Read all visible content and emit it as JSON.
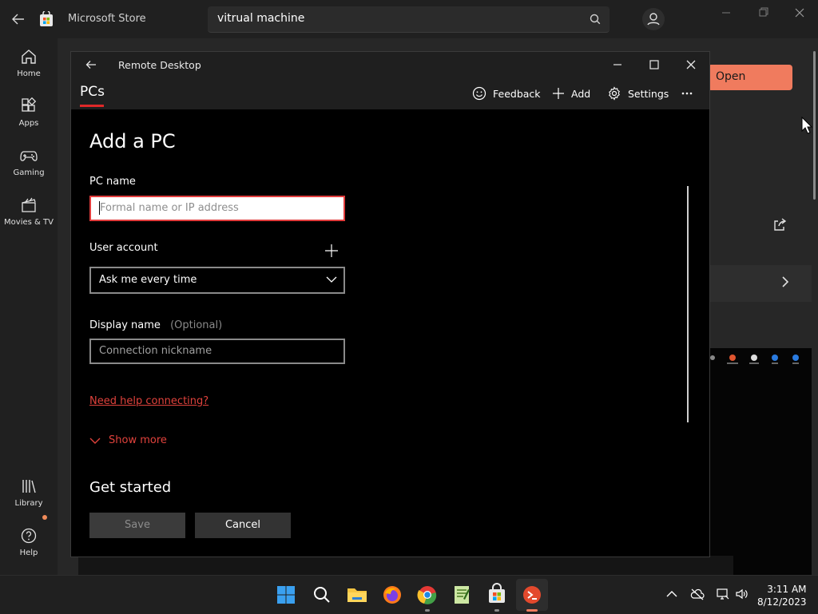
{
  "store": {
    "title": "Microsoft Store",
    "search_value": "vitrual machine",
    "open_label": "Open",
    "nav": [
      {
        "label": "Home",
        "icon": "home-icon"
      },
      {
        "label": "Apps",
        "icon": "apps-icon"
      },
      {
        "label": "Gaming",
        "icon": "gaming-icon"
      },
      {
        "label": "Movies & TV",
        "icon": "movies-icon"
      },
      {
        "label": "Library",
        "icon": "library-icon"
      },
      {
        "label": "Help",
        "icon": "help-icon"
      }
    ]
  },
  "rd": {
    "title": "Remote Desktop",
    "tab": "PCs",
    "toolbar": {
      "feedback": "Feedback",
      "add": "Add",
      "settings": "Settings"
    },
    "heading": "Add a PC",
    "pc_name": {
      "label": "PC name",
      "placeholder": "Formal name or IP address"
    },
    "user_account": {
      "label": "User account",
      "value": "Ask me every time"
    },
    "display_name": {
      "label": "Display name",
      "optional": "(Optional)",
      "placeholder": "Connection nickname"
    },
    "help_link": "Need help connecting?",
    "show_more": "Show more",
    "get_started": "Get started",
    "save": "Save",
    "cancel": "Cancel"
  },
  "taskbar": {
    "time": "3:11 AM",
    "date": "8/12/2023"
  },
  "colors": {
    "accent": "#e02828",
    "link": "#e0423c",
    "store_open": "#f07b5e"
  }
}
